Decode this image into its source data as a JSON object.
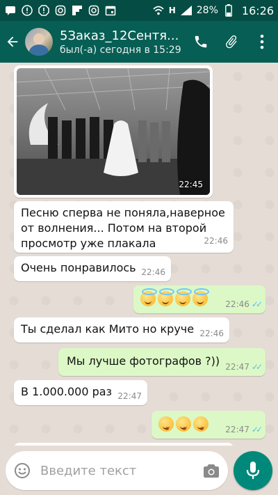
{
  "status_bar": {
    "time": "16:26",
    "battery_percent": "28%",
    "network_type": "H",
    "icons": [
      "message-icon",
      "warning-icon",
      "alert-icon",
      "instagram-icon",
      "flipboard-icon",
      "instagram-icon",
      "calendar-icon",
      "wifi-icon",
      "signal-icon",
      "battery-icon"
    ]
  },
  "header": {
    "title": "5Заказ_12Сентя...",
    "subtitle": "был(-а) сегодня в 15:29",
    "icons": [
      "back-arrow-icon",
      "phone-icon",
      "paperclip-icon",
      "more-vert-icon"
    ]
  },
  "messages": [
    {
      "type": "photo",
      "direction": "in",
      "time": "22:45"
    },
    {
      "type": "text",
      "direction": "in",
      "text": "Песню сперва не поняла,наверное от волнения... Потом на второй просмотр уже плакала",
      "time": "22:46"
    },
    {
      "type": "text",
      "direction": "in",
      "text": "Очень понравилось",
      "time": "22:46"
    },
    {
      "type": "emoji",
      "direction": "out",
      "emoji": "😇😇😇😇",
      "time": "22:46",
      "status": "read"
    },
    {
      "type": "text",
      "direction": "in",
      "text": "Ты сделал как Мито но круче",
      "time": "22:46"
    },
    {
      "type": "text",
      "direction": "out",
      "text": "Мы лучше фотографов ?))",
      "time": "22:47",
      "status": "read"
    },
    {
      "type": "text",
      "direction": "in",
      "text": "В 1.000.000 раз",
      "time": "22:47"
    },
    {
      "type": "emoji",
      "direction": "out",
      "emoji": "😋😋😋",
      "time": "22:47",
      "status": "read"
    }
  ],
  "input": {
    "placeholder": "Введите текст"
  },
  "colors": {
    "header": "#075e54",
    "status_bar": "#054d44",
    "outgoing_bubble": "#dcf8c6",
    "incoming_bubble": "#ffffff",
    "read_ticks": "#4fc3f7",
    "mic_button": "#00897b"
  }
}
